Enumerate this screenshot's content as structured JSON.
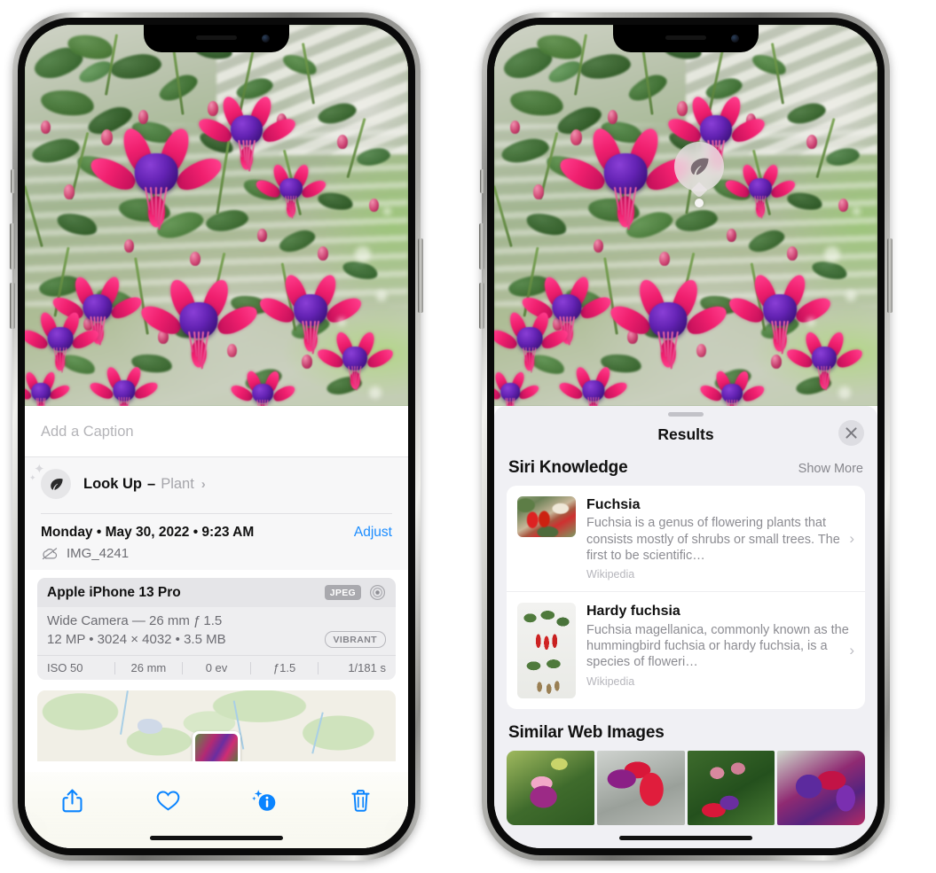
{
  "left_phone": {
    "photo": {
      "alt": "fuchsia-flowers-hanging-basket"
    },
    "caption_field": {
      "placeholder": "Add a Caption",
      "value": ""
    },
    "look_up": {
      "label": "Look Up",
      "dash": "–",
      "subject": "Plant",
      "chevron": "›",
      "icon": "leaf-icon"
    },
    "metadata": {
      "date": "Monday • May 30, 2022 • 9:23 AM",
      "adjust_label": "Adjust",
      "filename": "IMG_4241",
      "cloud_icon": "cloud-slash-icon"
    },
    "camera_card": {
      "device": "Apple iPhone 13 Pro",
      "format_badge": "JPEG",
      "lens_icon": "aperture-icon",
      "lens_line": "Wide Camera — 26 mm ƒ 1.5",
      "specs_line": "12 MP • 3024 × 4032 • 3.5 MB",
      "style_badge": "VIBRANT",
      "exif": [
        "ISO 50",
        "26 mm",
        "0 ev",
        "ƒ1.5",
        "1/181 s"
      ]
    },
    "map": {
      "pin": "photo-thumbnail-pin"
    },
    "toolbar": [
      {
        "name": "share-button",
        "icon": "share-icon"
      },
      {
        "name": "favorite-button",
        "icon": "heart-icon"
      },
      {
        "name": "info-button",
        "icon": "info-sparkle-icon"
      },
      {
        "name": "delete-button",
        "icon": "trash-icon"
      }
    ],
    "accent_color": "#1a8cff"
  },
  "right_phone": {
    "photo": {
      "alt": "fuchsia-flowers-hanging-basket"
    },
    "visual_lookup_badge": {
      "icon": "leaf-icon",
      "tooltip": "plant-detected"
    },
    "results_panel": {
      "title": "Results",
      "close_icon": "close-icon",
      "siri_knowledge": {
        "title": "Siri Knowledge",
        "show_more": "Show More",
        "items": [
          {
            "title": "Fuchsia",
            "description": "Fuchsia is a genus of flowering plants that consists mostly of shrubs or small trees. The first to be scientific…",
            "source": "Wikipedia",
            "thumb": "fuchsia-red-flowers",
            "chevron": "›"
          },
          {
            "title": "Hardy fuchsia",
            "description": "Fuchsia magellanica, commonly known as the hummingbird fuchsia or hardy fuchsia, is a species of floweri…",
            "source": "Wikipedia",
            "thumb": "hardy-fuchsia-specimen",
            "chevron": "›"
          }
        ]
      },
      "similar_web_images": {
        "title": "Similar Web Images",
        "images": [
          {
            "name": "fuchsia-web-image-1"
          },
          {
            "name": "fuchsia-web-image-2"
          },
          {
            "name": "fuchsia-web-image-3"
          },
          {
            "name": "fuchsia-web-image-4"
          }
        ]
      }
    }
  }
}
